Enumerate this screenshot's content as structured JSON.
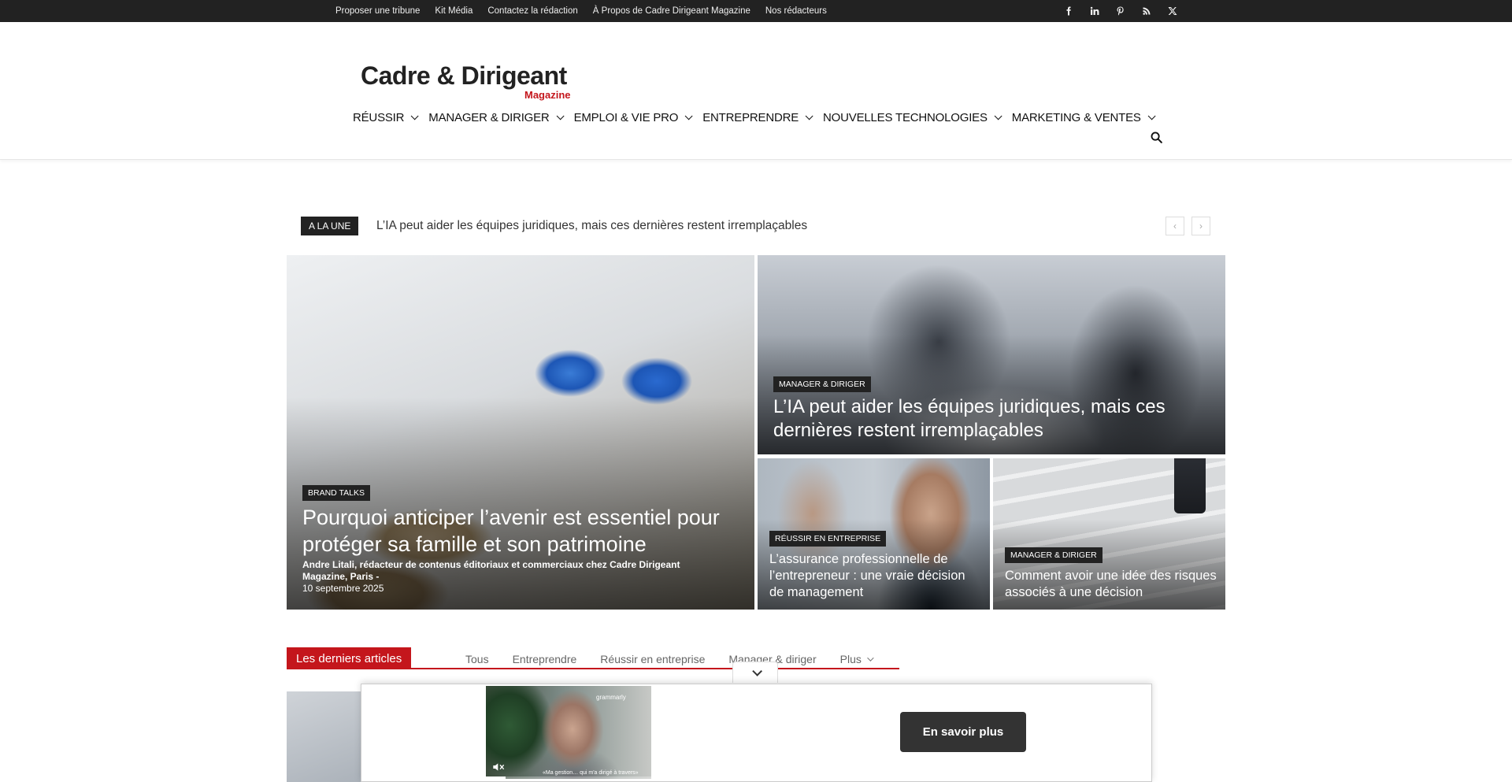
{
  "topbar": {
    "links": [
      "Proposer une tribune",
      "Kit Média",
      "Contactez la rédaction",
      "À Propos de Cadre Dirigeant Magazine",
      "Nos rédacteurs"
    ],
    "socials": [
      "facebook-icon",
      "linkedin-icon",
      "pinterest-icon",
      "rss-icon",
      "x-icon"
    ]
  },
  "logo": {
    "main": "Cadre & Dirigeant",
    "sub": "Magazine"
  },
  "nav": {
    "items": [
      "RÉUSSIR",
      "MANAGER & DIRIGER",
      "EMPLOI & VIE PRO",
      "ENTREPRENDRE",
      "NOUVELLES TECHNOLOGIES",
      "MARKETING & VENTES"
    ]
  },
  "ticker": {
    "label": "A LA UNE",
    "text": "L’IA peut aider les équipes juridiques, mais ces dernières restent irremplaçables"
  },
  "featured": {
    "main": {
      "category": "BRAND TALKS",
      "title": "Pourquoi anticiper l’avenir est essentiel pour protéger sa famille et son patrimoine",
      "author": "Andre Litali, rédacteur de contenus éditoriaux et commerciaux chez Cadre Dirigeant Magazine, Paris",
      "date": "10 septembre 2025"
    },
    "top_right": {
      "category": "MANAGER & DIRIGER",
      "title": "L’IA peut aider les équipes juridiques, mais ces dernières restent irremplaçables"
    },
    "bottom_left": {
      "category": "RÉUSSIR EN ENTREPRISE",
      "title": "L’assurance professionnelle de l’entrepreneur : une vraie décision de management"
    },
    "bottom_right": {
      "category": "MANAGER & DIRIGER",
      "title": "Comment avoir une idée des risques associés à une décision"
    }
  },
  "latest": {
    "label": "Les derniers articles",
    "tabs": [
      "Tous",
      "Entreprendre",
      "Réussir en entreprise",
      "Manager & diriger"
    ],
    "more": "Plus"
  },
  "ad": {
    "brand": "grammarly",
    "caption": "«Ma gestion… qui m'a dirigé à travers»",
    "cta": "En savoir plus",
    "progress": 0.12
  }
}
